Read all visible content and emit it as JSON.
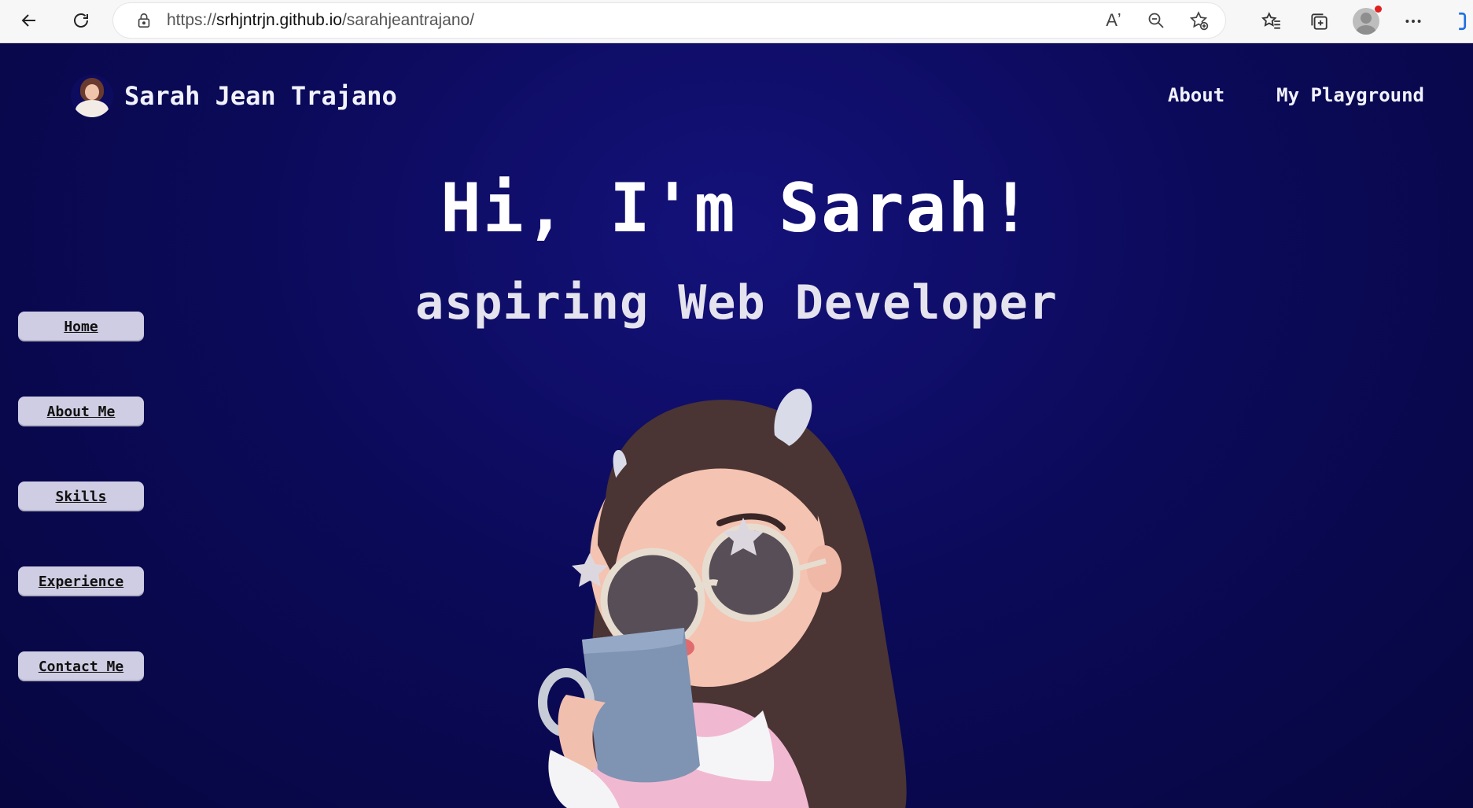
{
  "browser": {
    "url_prefix": "https://",
    "url_host": "srhjntrjn.github.io",
    "url_path": "/sarahjeantrajano/",
    "read_aloud_label": "Aʼ"
  },
  "site": {
    "brand_name": "Sarah Jean Trajano",
    "top_nav": [
      "About",
      "My Playground"
    ],
    "hero_title": "Hi, I'm Sarah!",
    "hero_subtitle": "aspiring Web Developer",
    "side_nav": [
      "Home",
      "About Me",
      "Skills",
      "Experience",
      "Contact Me"
    ]
  },
  "colors": {
    "page_bg": "#0b0a5a",
    "side_button_bg": "#cfcde3",
    "text_light": "#f2f2ff"
  }
}
